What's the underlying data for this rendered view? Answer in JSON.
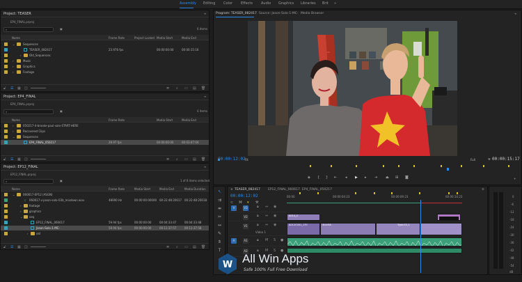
{
  "workspaces": [
    {
      "label": "Assembly",
      "active": true
    },
    {
      "label": "Editing",
      "active": false
    },
    {
      "label": "Color",
      "active": false
    },
    {
      "label": "Effects",
      "active": false
    },
    {
      "label": "Audio",
      "active": false
    },
    {
      "label": "Graphics",
      "active": false
    },
    {
      "label": "Libraries",
      "active": false
    },
    {
      "label": "Brit",
      "active": false
    }
  ],
  "project1": {
    "title": "Project: TEASER",
    "filename": "EP4_FINAL.prproj",
    "count": "6 items",
    "columns": [
      "Name",
      "Frame Rate",
      "Project Locked",
      "Media Start",
      "Media End"
    ],
    "rows": [
      {
        "name": "Sequences",
        "type": "folder",
        "swatch": "#c8a640"
      },
      {
        "name": "TEASER_082417",
        "type": "seq",
        "swatch": "#3aa0b5",
        "fps": "23.976 fps",
        "start": "00:00:00:00",
        "end": "00:00:15:16"
      },
      {
        "name": "Old_Sequences",
        "type": "folder",
        "swatch": "#c8a640"
      },
      {
        "name": "Music",
        "type": "folder",
        "swatch": "#c8a640"
      },
      {
        "name": "Graphics",
        "type": "folder",
        "swatch": "#c8a640"
      },
      {
        "name": "Footage",
        "type": "folder",
        "swatch": "#c8a640"
      }
    ]
  },
  "project2": {
    "title": "Project: EP4_FINAL",
    "filename": "EP4_FINAL.prproj",
    "count": "4 items",
    "columns": [
      "Name",
      "Frame Rate",
      "Media Start",
      "Media End"
    ],
    "rows": [
      {
        "name": "050217-d-brooke-paul-solo-START-HERE",
        "type": "folder",
        "swatch": "#c8a640"
      },
      {
        "name": "Recovered Clips",
        "type": "folder",
        "swatch": "#c8a640"
      },
      {
        "name": "Sequences",
        "type": "folder",
        "swatch": "#c8a640"
      },
      {
        "name": "EP4_FINAL_050217",
        "type": "seq",
        "swatch": "#3aa0b5",
        "fps": "29.97 fps",
        "start": "00:00:00:00",
        "end": "00:03:47:04",
        "selected": true
      }
    ]
  },
  "project3": {
    "title": "Project: EP12_FINAL",
    "filename": "EP12_FINAL.prproj",
    "count": "1 of 8 items selected",
    "columns": [
      "Name",
      "Frame Rate",
      "Media Start",
      "Media End",
      "Media Duration"
    ],
    "rows": [
      {
        "name": "060617-EP12 (ASGN)",
        "type": "folder",
        "swatch": "#c8a640"
      },
      {
        "name": "060617-v-jason-solo-03b_mixdown.wav",
        "type": "audio",
        "swatch": "#3aa07a",
        "fps": "48000 Hz",
        "start": "00:00:00:00000",
        "end": "00:22:48:20017",
        "dur": "00:22:48:20018"
      },
      {
        "name": "footage",
        "type": "folder",
        "swatch": "#c8a640"
      },
      {
        "name": "graphics",
        "type": "folder",
        "swatch": "#c8a640"
      },
      {
        "name": "seq",
        "type": "folder",
        "swatch": "#c8a640"
      },
      {
        "name": "EP12_FINAL_060617",
        "type": "seq",
        "swatch": "#3aa0b5",
        "fps": "59.94 fps",
        "start": "00:00:00:00",
        "end": "00:04:33:47",
        "dur": "00:04:33:48"
      },
      {
        "name": "Jason-Solo-1-MC-",
        "type": "seq",
        "swatch": "#3aa0b5",
        "fps": "59.94 fps",
        "start": "00:00:00:00",
        "end": "00:11:37:57",
        "dur": "00:11:37:58",
        "selected": true
      },
      {
        "name": "old",
        "type": "folder",
        "swatch": "#c8a640"
      }
    ]
  },
  "monitor": {
    "tabs": [
      "Program: TEASER_082417",
      "Source: Jason-Solo-1-MC-",
      "Media Browser"
    ],
    "timecode_left": "00:00:12:02",
    "timecode_right": "00:00:15:17",
    "fit": "Fit",
    "quality": "Full"
  },
  "timeline": {
    "tabs": [
      "TEASER_082417",
      "EP12_FINAL_060617",
      "EP4_FINAL_050217"
    ],
    "timecode": "00:00:12:02",
    "ruler": [
      "00:00",
      "00:00:04:23",
      "00:00:09:23",
      "00:00:14:23"
    ],
    "tracks": [
      "V3",
      "V2",
      "V1",
      "A1",
      "A2"
    ],
    "video_label": "Video 1",
    "clip_labels": [
      "A014_C",
      "A012C001_170",
      "4ncc9A",
      "Type-03_1"
    ],
    "meter_labels": [
      "0",
      "-6",
      "-12",
      "-18",
      "-24",
      "-30",
      "-36",
      "-42",
      "-48",
      "-54"
    ],
    "meter_unit": "dB"
  },
  "watermark": {
    "brand": "All Win Apps",
    "tagline": "Safe 100% Full Free Download"
  }
}
